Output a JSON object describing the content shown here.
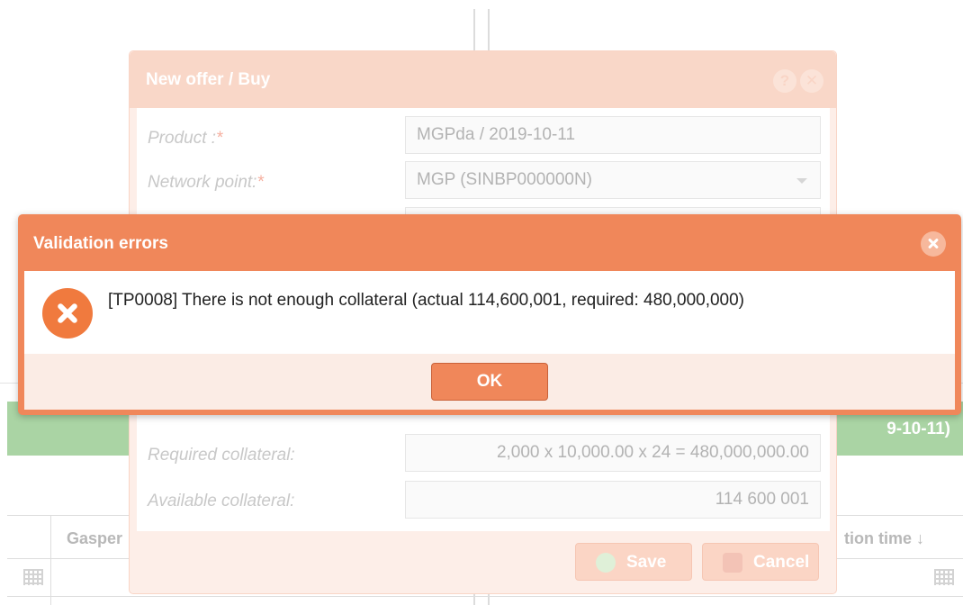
{
  "background": {
    "green_bar_text": "9-10-11)",
    "table": {
      "header_col1": "Gasper",
      "header_col2": "tion time",
      "sort_glyph": "↓"
    }
  },
  "offer_dialog": {
    "title": "New offer / Buy",
    "help_glyph": "?",
    "close_glyph": "✕",
    "fields": {
      "product_label": "Product :",
      "product_value": "MGPda / 2019-10-11",
      "network_point_label": "Network point:",
      "network_point_value": "MGP (SINBP000000N)",
      "required_star": "*",
      "required_collateral_label": "Required collateral:",
      "required_collateral_value": "2,000 x 10,000.00 x 24 = 480,000,000.00",
      "available_collateral_label": "Available collateral:",
      "available_collateral_value": "114 600 001"
    },
    "save_label": "Save",
    "cancel_label": "Cancel"
  },
  "validation_dialog": {
    "title": "Validation errors",
    "message": "[TP0008] There is not enough collateral (actual 114,600,001, required: 480,000,000)",
    "ok_label": "OK"
  },
  "colors": {
    "accent": "#f0875a",
    "error_icon": "#f07a3e",
    "green_bar": "#aad4a4"
  }
}
